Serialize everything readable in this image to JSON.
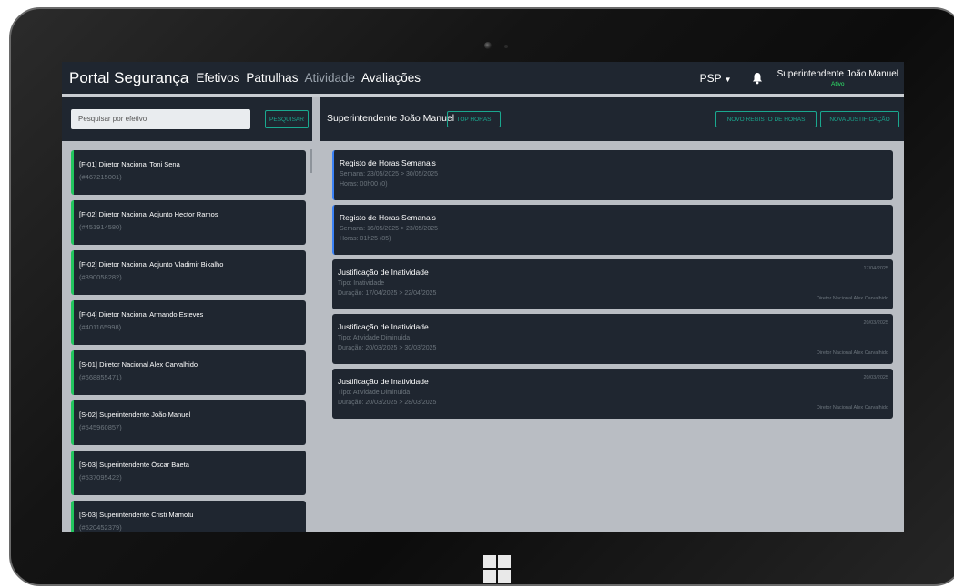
{
  "navbar": {
    "brand": "Portal Segurança",
    "links": [
      "Efetivos",
      "Patrulhas",
      "Atividade",
      "Avaliações"
    ],
    "org_selector": "PSP",
    "user_name": "Superintendente João Manuel",
    "user_status": "Ativo"
  },
  "search": {
    "placeholder": "Pesquisar por efetivo",
    "button": "PESQUISAR"
  },
  "employees": [
    {
      "name": "[F-01] Diretor Nacional Toni Sena",
      "id": "(#467215001)"
    },
    {
      "name": "[F-02] Diretor Nacional Adjunto Hector Ramos",
      "id": "(#451914580)"
    },
    {
      "name": "[F-02] Diretor Nacional Adjunto Vladimir Bikalho",
      "id": "(#390058282)"
    },
    {
      "name": "[F-04] Diretor Nacional Armando Esteves",
      "id": "(#401165998)"
    },
    {
      "name": "[S-01] Diretor Nacional Alex Carvalhido",
      "id": "(#668855471)"
    },
    {
      "name": "[S-02] Superintendente João Manuel",
      "id": "(#545960857)"
    },
    {
      "name": "[S-03] Superintendente Óscar Baeta",
      "id": "(#537095422)"
    },
    {
      "name": "[S-03] Superintendente Cristi Mamotu",
      "id": "(#520452379)"
    }
  ],
  "detail": {
    "title": "Superintendente João Manuel",
    "top_hours_button": "TOP HORAS",
    "new_hours_button": "NOVO REGISTO DE HORAS",
    "new_justification_button": "NOVA JUSTIFICAÇÃO"
  },
  "entries": [
    {
      "title": "Registo de Horas Semanais",
      "line1": "Semana: 23/05/2025 > 30/05/2025",
      "line2": "Horas: 00h00 (0)",
      "date": "",
      "author": ""
    },
    {
      "title": "Registo de Horas Semanais",
      "line1": "Semana: 16/05/2025 > 23/05/2025",
      "line2": "Horas: 01h25 (85)",
      "date": "",
      "author": ""
    },
    {
      "title": "Justificação de Inatividade",
      "line1": "Tipo: Inatividade",
      "line2": "Duração: 17/04/2025 > 22/04/2025",
      "date": "17/04/2025",
      "author": "Diretor Nacional Alex Carvalhido"
    },
    {
      "title": "Justificação de Inatividade",
      "line1": "Tipo: Atividade Diminuída",
      "line2": "Duração: 20/03/2025 > 30/03/2025",
      "date": "20/03/2025",
      "author": "Diretor Nacional Alex Carvalhido"
    },
    {
      "title": "Justificação de Inatividade",
      "line1": "Tipo: Atividade Diminuída",
      "line2": "Duração: 20/03/2025 > 28/03/2025",
      "date": "20/03/2025",
      "author": "Diretor Nacional Alex Carvalhido"
    }
  ],
  "colors": {
    "panel": "#1f2630",
    "accent_teal": "#1aa88f",
    "active_green": "#22c55e",
    "hours_blue": "#3b82f6",
    "screen_bg": "#b9bdc3"
  }
}
